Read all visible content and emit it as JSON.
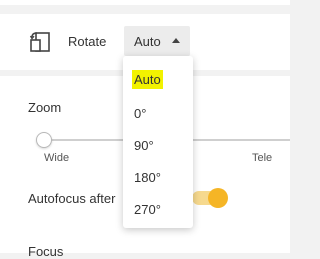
{
  "rotate": {
    "icon": "rotate-screen-icon",
    "label": "Rotate",
    "selected": "Auto",
    "options": [
      "Auto",
      "0°",
      "90°",
      "180°",
      "270°"
    ]
  },
  "zoom": {
    "label": "Zoom",
    "min_label": "Wide",
    "max_label": "Tele",
    "value_fraction": 0.0
  },
  "autofocus": {
    "label": "Autofocus after",
    "enabled": true
  },
  "focus": {
    "label": "Focus"
  },
  "colors": {
    "toggle_accent": "#f5b526",
    "highlight": "#f2f200"
  }
}
